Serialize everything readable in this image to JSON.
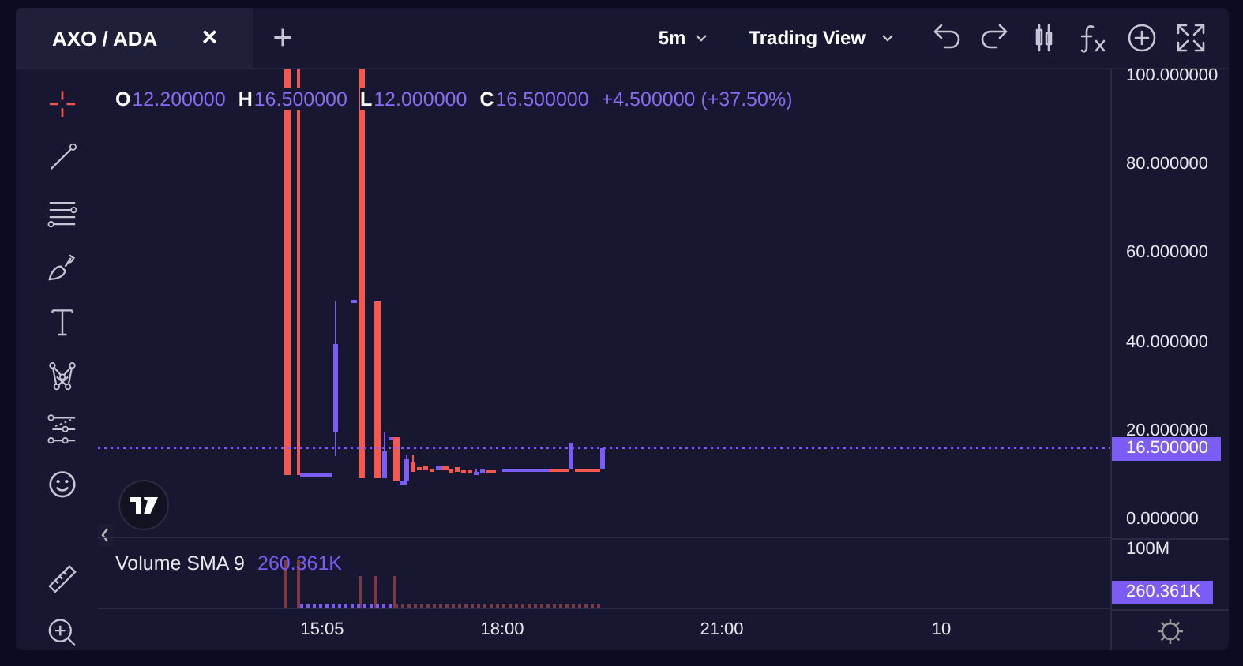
{
  "tab": {
    "label": "AXO / ADA",
    "close": "×"
  },
  "add_tab": "+",
  "interval": "5m",
  "layout": "Trading View",
  "header_tools": [
    {
      "kind": "undo"
    },
    {
      "kind": "redo"
    },
    {
      "kind": "candles"
    },
    {
      "kind": "function"
    },
    {
      "kind": "add"
    },
    {
      "kind": "fullscreen"
    }
  ],
  "tools": [
    {
      "kind": "crosshair",
      "selected": true
    },
    {
      "kind": "line",
      "selected": false
    },
    {
      "kind": "hlines",
      "selected": false
    },
    {
      "kind": "brush",
      "selected": false
    },
    {
      "kind": "text",
      "selected": false
    },
    {
      "kind": "pattern",
      "selected": false
    },
    {
      "kind": "levels",
      "selected": false
    },
    {
      "kind": "emoji",
      "selected": false
    },
    {
      "kind": "ruler",
      "selected": false
    },
    {
      "kind": "zoom",
      "selected": false
    }
  ],
  "legend": [
    {
      "label": "O",
      "value": "12.200000"
    },
    {
      "label": "H",
      "value": "16.500000"
    },
    {
      "label": "L",
      "value": "12.000000"
    },
    {
      "label": "C",
      "value": "16.500000"
    }
  ],
  "change": "+4.500000 (+37.50%)",
  "price_axis": {
    "ticks": [
      "100.000000",
      "80.000000",
      "60.000000",
      "40.000000",
      "20.000000",
      "0.000000"
    ],
    "last_price": "16.500000"
  },
  "volume": {
    "title": "Volume SMA 9",
    "value": "260.361K",
    "axis_max": "100M",
    "last_value": "260.361K"
  },
  "time_axis": [
    "15:05",
    "18:00",
    "21:00",
    "10"
  ]
}
